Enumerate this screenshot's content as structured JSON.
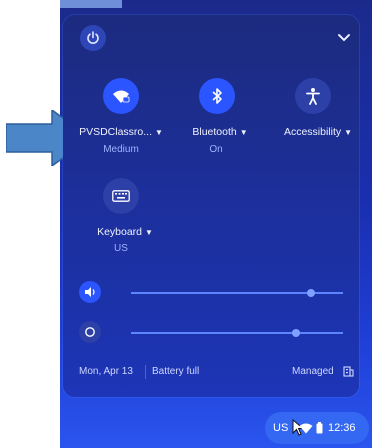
{
  "panel": {
    "tiles": [
      {
        "label": "PVSDClassro...",
        "sublabel": "Medium",
        "icon": "wifi-icon",
        "state": "on"
      },
      {
        "label": "Bluetooth",
        "sublabel": "On",
        "icon": "bluetooth-icon",
        "state": "on"
      },
      {
        "label": "Accessibility",
        "sublabel": "",
        "icon": "accessibility-icon",
        "state": "off"
      },
      {
        "label": "Keyboard",
        "sublabel": "US",
        "icon": "keyboard-icon",
        "state": "off"
      }
    ],
    "sliders": [
      {
        "name": "volume",
        "icon": "volume-icon",
        "level": 0.85
      },
      {
        "name": "brightness",
        "icon": "brightness-icon",
        "level": 0.78
      }
    ],
    "footer": {
      "date": "Mon, Apr 13",
      "battery": "Battery full",
      "managed": "Managed"
    }
  },
  "tray": {
    "keyboard_layout": "US",
    "time": "12:36"
  },
  "colors": {
    "accent": "#2b55ff",
    "panel_bg": "#1c2f9c",
    "annotation_arrow": "#4a86c8"
  }
}
